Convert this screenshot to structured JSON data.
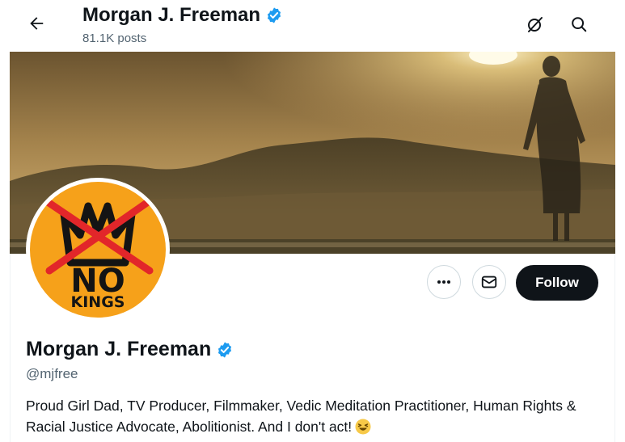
{
  "header": {
    "display_name": "Morgan J. Freeman",
    "post_count": "81.1K posts"
  },
  "profile": {
    "display_name": "Morgan J. Freeman",
    "handle": "@mjfree",
    "bio": "Proud Girl Dad, TV Producer, Filmmaker, Vedic Meditation Practitioner, Human Rights & Racial Justice Advocate, Abolitionist. And I don't act!",
    "avatar_text_top": "NO",
    "avatar_text_bottom": "KINGS",
    "follow_label": "Follow",
    "avatar_bg_color": "#f6a11a",
    "verified_color": "#1d9bf0"
  },
  "icons": [
    "back-arrow-icon",
    "verified-badge-icon",
    "grok-icon",
    "search-icon",
    "more-icon",
    "mail-icon",
    "laughing-emoji-icon"
  ]
}
